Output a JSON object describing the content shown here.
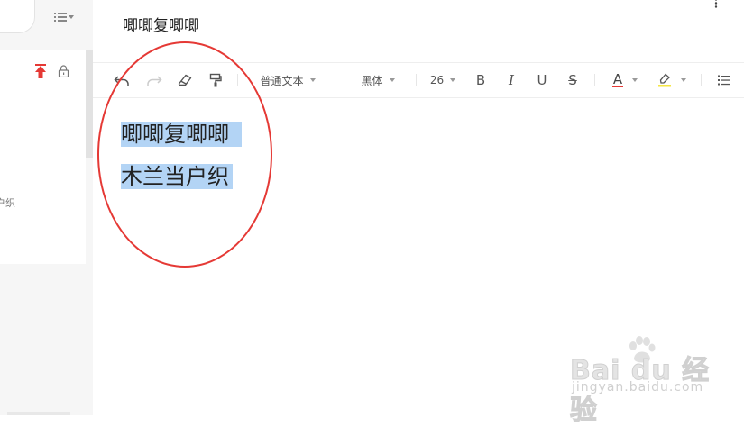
{
  "note": {
    "title": "唧唧复唧唧",
    "snippet": "户织"
  },
  "toolbar": {
    "paragraph_style": "普通文本",
    "font_family": "黑体",
    "font_size": "26",
    "bold": "B",
    "italic": "I",
    "underline": "U",
    "strike": "S",
    "font_color": "A"
  },
  "editor": {
    "lines": [
      "唧唧复唧唧",
      "木兰当户织"
    ]
  },
  "watermark": {
    "brand": "Bai du 经验",
    "url": "jingyan.baidu.com"
  },
  "colors": {
    "selection": "#b3d4f5",
    "annotation_ring": "#e53935",
    "pin": "#e53935",
    "highlight_marker": "#f5e642"
  },
  "icons": [
    "list-view-icon",
    "pin-top-icon",
    "lock-icon",
    "undo-icon",
    "redo-icon",
    "eraser-icon",
    "format-painter-icon",
    "font-color-icon",
    "highlight-icon",
    "bullet-list-icon",
    "more-icon"
  ]
}
